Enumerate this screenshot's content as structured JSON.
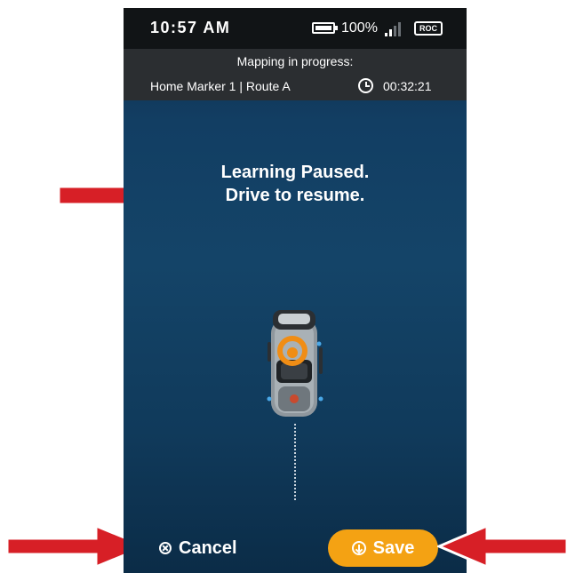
{
  "status_bar": {
    "time": "10:57 AM",
    "battery_percent": "100%",
    "badge": "ROC"
  },
  "mapping": {
    "title": "Mapping in progress:",
    "route": "Home Marker 1 | Route A",
    "elapsed": "00:32:21"
  },
  "message": {
    "line1": "Learning Paused.",
    "line2": "Drive to resume."
  },
  "actions": {
    "cancel_label": "Cancel",
    "save_label": "Save"
  },
  "colors": {
    "save_button": "#f4a213",
    "annotation_arrow": "#d71f26",
    "background": "#144468"
  },
  "icons": [
    "battery-icon",
    "signal-icon",
    "clock-icon",
    "cancel-icon",
    "save-icon",
    "vehicle-icon"
  ]
}
